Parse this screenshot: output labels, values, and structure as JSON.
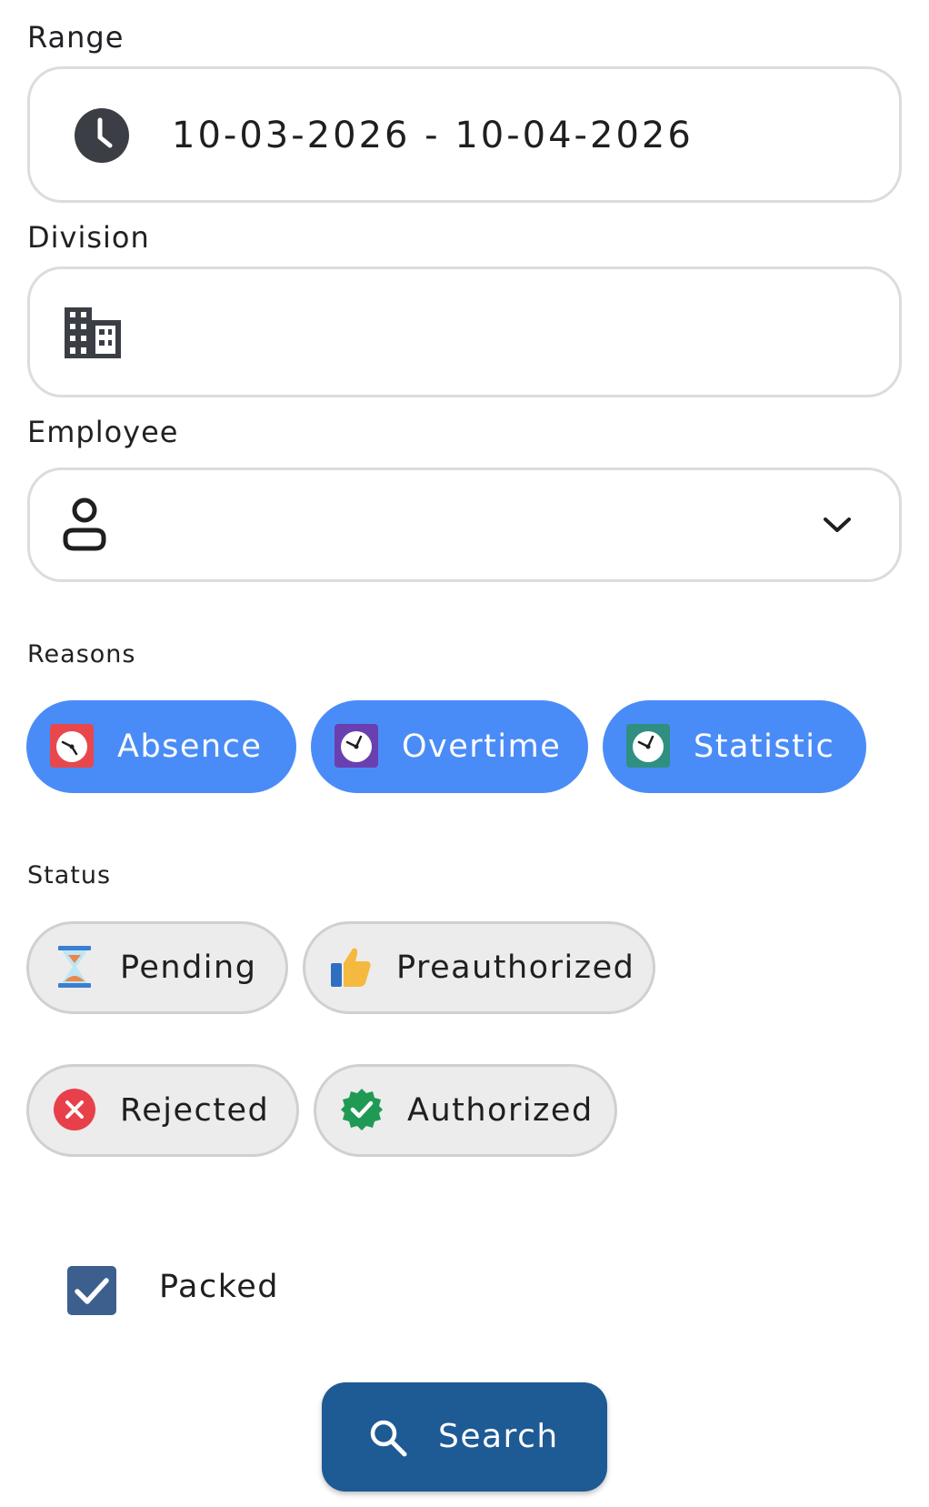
{
  "range": {
    "label": "Range",
    "value": "10-03-2026 - 10-04-2026",
    "icon": "clock-icon"
  },
  "division": {
    "label": "Division",
    "value": "",
    "icon": "building-icon"
  },
  "employee": {
    "label": "Employee",
    "value": "",
    "icon": "person-icon",
    "dropdown_icon": "chevron-down-icon"
  },
  "reasons": {
    "label": "Reasons",
    "items": [
      {
        "label": "Absence",
        "icon": "alarm-clock-icon",
        "icon_color": "#e8474c",
        "selected": true
      },
      {
        "label": "Overtime",
        "icon": "alarm-clock-icon",
        "icon_color": "#6a3fb0",
        "selected": true
      },
      {
        "label": "Statistic",
        "icon": "alarm-clock-icon",
        "icon_color": "#2f8f80",
        "selected": true
      }
    ]
  },
  "status": {
    "label": "Status",
    "items": [
      {
        "label": "Pending",
        "icon": "hourglass-icon",
        "selected": false
      },
      {
        "label": "Preauthorized",
        "icon": "thumbs-up-icon",
        "selected": false
      },
      {
        "label": "Rejected",
        "icon": "cross-mark-icon",
        "selected": false
      },
      {
        "label": "Authorized",
        "icon": "check-badge-icon",
        "selected": false
      }
    ]
  },
  "packed": {
    "label": "Packed",
    "checked": true
  },
  "search_button": {
    "label": "Search",
    "icon": "search-icon"
  },
  "colors": {
    "chip_selected": "#4a8cf7",
    "chip_unselected": "#ececec",
    "primary_button": "#1e5a94",
    "checkbox": "#3c5f8e"
  }
}
